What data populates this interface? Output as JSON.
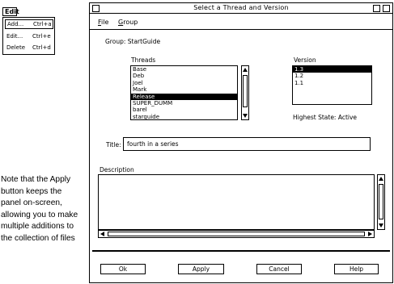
{
  "edit_menu": {
    "title": "Edit",
    "items": [
      {
        "label": "Add...",
        "shortcut": "Ctrl+a"
      },
      {
        "label": "Edit...",
        "shortcut": "Ctrl+e"
      },
      {
        "label": "Delete",
        "shortcut": "Ctrl+d"
      }
    ]
  },
  "note": {
    "text": "Note that the Apply button keeps the panel on-screen, allowing you to make multiple additions to the collection of files"
  },
  "window": {
    "title": "Select a Thread and Version",
    "menubar": {
      "file": {
        "underlined": "F",
        "rest": "ile"
      },
      "group": {
        "underlined": "G",
        "rest": "roup"
      }
    },
    "group_line": "Group:  StartGuide",
    "threads": {
      "label": "Threads",
      "items": [
        "Base",
        "Deb",
        "Joel",
        "Mark",
        "Release",
        "SUPER_DUMM",
        "barel",
        "starguide"
      ],
      "selected_index": 4
    },
    "version": {
      "label": "Version",
      "items": [
        "1.3",
        "1.2",
        "1.1"
      ],
      "selected_index": 0
    },
    "highest_state": "Highest State:  Active",
    "title_field": {
      "label": "Title:",
      "value": "fourth in a series"
    },
    "description_label": "Description",
    "buttons": {
      "ok": "Ok",
      "apply": "Apply",
      "cancel": "Cancel",
      "help": "Help"
    }
  }
}
